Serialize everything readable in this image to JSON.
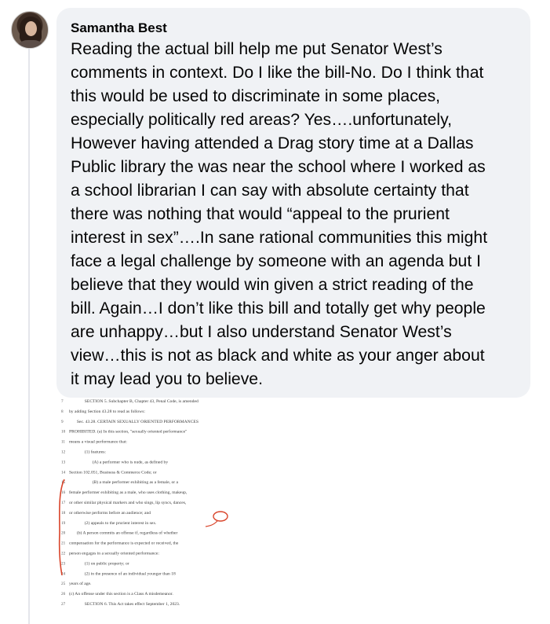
{
  "comment": {
    "author": "Samantha Best",
    "text": "Reading the actual bill help me put Senator West’s\ncomments in context. Do I like the bill-No. Do I think that\nthis would be used to discriminate in some places,\nespecially politically red areas? Yes….unfortunately,\nHowever having attended a Drag story time at a Dallas\nPublic library the was near the school where I worked as\na school librarian I can say with absolute certainty that\nthere was nothing that would “appeal to the prurient\ninterest in sex”….In sane rational communities this might\nface a legal challenge by someone with an agenda but I\nbelieve that they would win given a strict reading of the\nbill. Again…I don’t like this bill and totally get why people\nare unhappy…but I also understand Senator West’s\nview…this is not as black and white as your anger about\nit may lead you to believe."
  },
  "attachment": {
    "annotation_color": "#d9452b",
    "lines": [
      {
        "num": "7",
        "text": "SECTION 5. Subchapter B, Chapter 43, Penal Code, is amended"
      },
      {
        "num": "8",
        "text": "by adding Section 43.28 to read as follows:"
      },
      {
        "num": "9",
        "text": "Sec. 43.28. CERTAIN SEXUALLY ORIENTED PERFORMANCES"
      },
      {
        "num": "10",
        "text": "PROHIBITED. (a) In this section, \"sexually oriented performance\""
      },
      {
        "num": "11",
        "text": "means a visual performance that:"
      },
      {
        "num": "12",
        "text": "(1) features:"
      },
      {
        "num": "13",
        "text": "(A) a performer who is nude, as defined by"
      },
      {
        "num": "14",
        "text": "Section 102.051, Business & Commerce Code; or"
      },
      {
        "num": "15",
        "text": "(B) a male performer exhibiting as a female, or a"
      },
      {
        "num": "16",
        "text": "female performer exhibiting as a male, who uses clothing, makeup,"
      },
      {
        "num": "17",
        "text": "or other similar physical markers and who sings, lip syncs, dances,"
      },
      {
        "num": "18",
        "text": "or otherwise performs before an audience; and"
      },
      {
        "num": "19",
        "text": "(2) appeals to the prurient interest in sex."
      },
      {
        "num": "20",
        "text": "(b) A person commits an offense if, regardless of whether"
      },
      {
        "num": "21",
        "text": "compensation for the performance is expected or received, the"
      },
      {
        "num": "22",
        "text": "person engages in a sexually oriented performance:"
      },
      {
        "num": "23",
        "text": "(1) on public property; or"
      },
      {
        "num": "24",
        "text": "(2) in the presence of an individual younger than 18"
      },
      {
        "num": "25",
        "text": "years of age."
      },
      {
        "num": "26",
        "text": "(c) An offense under this section is a Class A misdemeanor."
      },
      {
        "num": "27",
        "text": "SECTION 6. This Act takes effect September 1, 2023."
      }
    ]
  }
}
